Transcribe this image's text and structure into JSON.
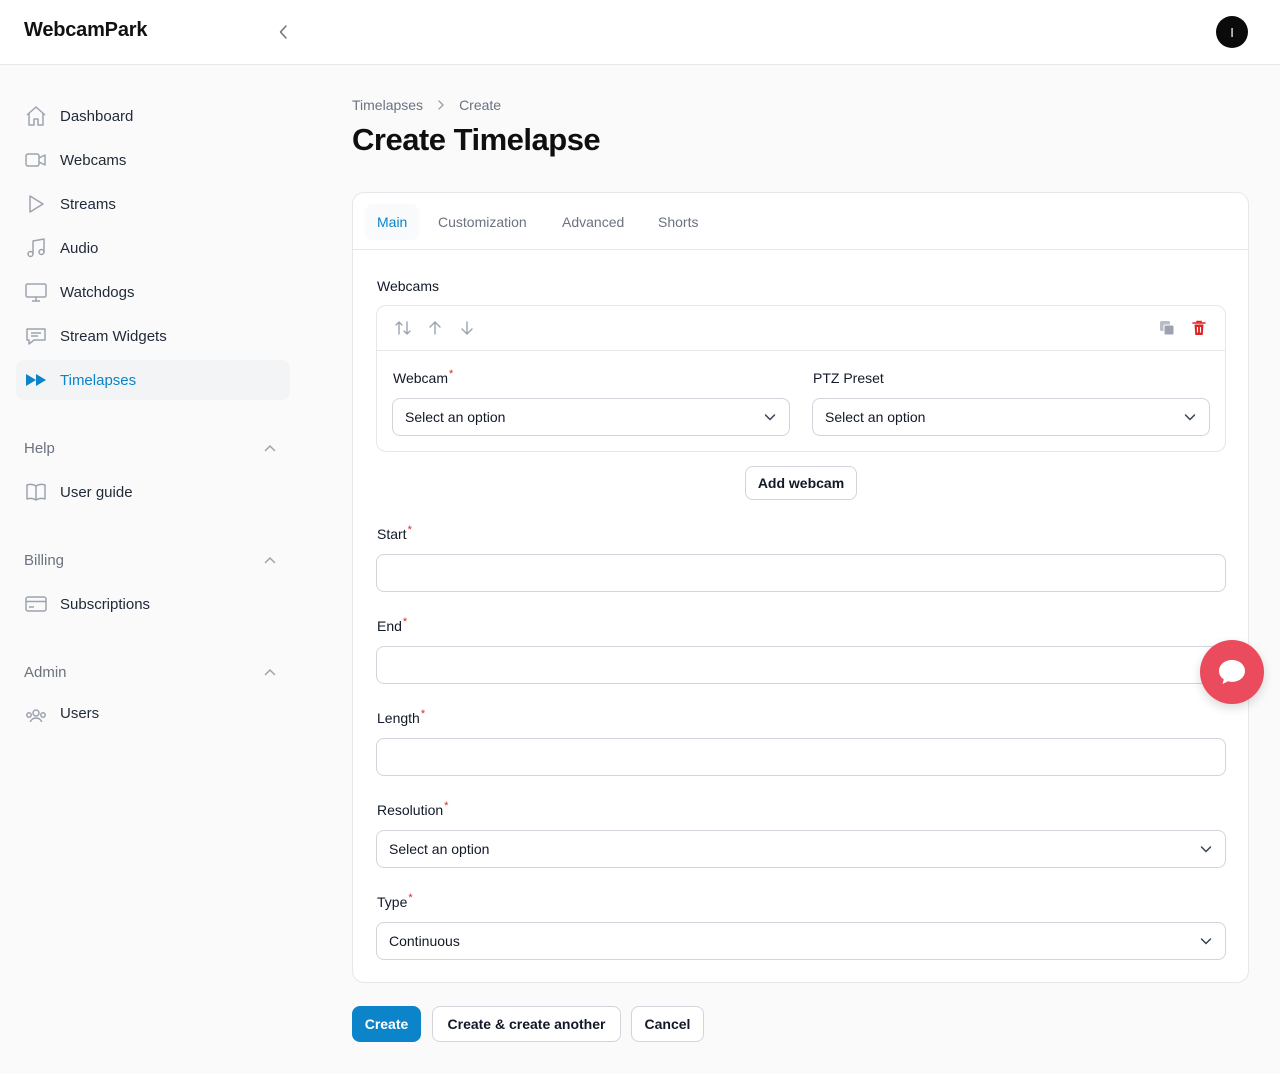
{
  "app": {
    "brand": "WebcamPark",
    "avatar_initial": "I"
  },
  "sidebar": {
    "items": [
      {
        "label": "Dashboard",
        "icon": "home-icon"
      },
      {
        "label": "Webcams",
        "icon": "video-camera-icon"
      },
      {
        "label": "Streams",
        "icon": "play-icon"
      },
      {
        "label": "Audio",
        "icon": "music-note-icon"
      },
      {
        "label": "Watchdogs",
        "icon": "monitor-icon"
      },
      {
        "label": "Stream Widgets",
        "icon": "chat-bubble-icon"
      },
      {
        "label": "Timelapses",
        "icon": "fast-forward-icon",
        "active": true
      }
    ],
    "groups": [
      {
        "label": "Help",
        "items": [
          {
            "label": "User guide",
            "icon": "book-icon"
          }
        ]
      },
      {
        "label": "Billing",
        "items": [
          {
            "label": "Subscriptions",
            "icon": "credit-card-icon"
          }
        ]
      },
      {
        "label": "Admin",
        "items": [
          {
            "label": "Users",
            "icon": "users-icon"
          }
        ]
      }
    ]
  },
  "breadcrumb": {
    "parent": "Timelapses",
    "current": "Create"
  },
  "page": {
    "title": "Create Timelapse"
  },
  "tabs": [
    {
      "label": "Main",
      "active": true
    },
    {
      "label": "Customization"
    },
    {
      "label": "Advanced"
    },
    {
      "label": "Shorts"
    }
  ],
  "form": {
    "webcams_label": "Webcams",
    "webcam": {
      "label": "Webcam",
      "value": "Select an option"
    },
    "ptz": {
      "label": "PTZ Preset",
      "value": "Select an option"
    },
    "add_webcam": "Add webcam",
    "start": {
      "label": "Start",
      "value": ""
    },
    "end": {
      "label": "End",
      "value": ""
    },
    "length": {
      "label": "Length",
      "value": ""
    },
    "resolution": {
      "label": "Resolution",
      "value": "Select an option"
    },
    "type": {
      "label": "Type",
      "value": "Continuous"
    },
    "required_mark": "*"
  },
  "actions": {
    "create": "Create",
    "create_another": "Create & create another",
    "cancel": "Cancel"
  },
  "colors": {
    "accent": "#0b84c9",
    "danger": "#dc2626",
    "chat": "#ea4c5d"
  }
}
